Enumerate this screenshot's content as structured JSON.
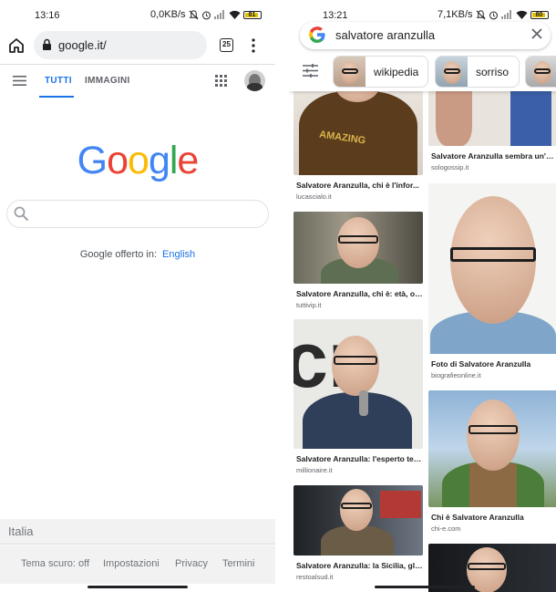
{
  "left": {
    "status": {
      "time": "13:16",
      "net": "0,0KB/s",
      "battery": "81"
    },
    "url": "google.it/",
    "tab_count": "25",
    "tabs": [
      {
        "label": "TUTTI"
      },
      {
        "label": "IMMAGINI"
      }
    ],
    "logo": {
      "G": "G",
      "o1": "o",
      "o2": "o",
      "g": "g",
      "l": "l",
      "e": "e"
    },
    "offered_text": "Google offerto in:",
    "offered_lang": "English",
    "country": "Italia",
    "footer": [
      "Tema scuro: off",
      "Impostazioni",
      "Privacy",
      "Termini"
    ]
  },
  "right": {
    "status": {
      "time": "13:21",
      "net": "7,1KB/s",
      "battery": "80"
    },
    "query": "salvatore aranzulla",
    "chips": [
      {
        "label": "wikipedia"
      },
      {
        "label": "sorriso"
      }
    ],
    "results": [
      {
        "title": "Salvatore Aranzulla, chi è l'infor...",
        "domain": "lucascialo.it"
      },
      {
        "title": "Salvatore Aranzulla, chi è: età, or...",
        "domain": "tuttivip.it"
      },
      {
        "title": "Salvatore Aranzulla: l'esperto tec...",
        "domain": "millionaire.it"
      },
      {
        "title": "Salvatore Aranzulla: la Sicilia, gli ...",
        "domain": "restoalsud.it"
      },
      {
        "title": "Salvatore Aranzulla sembra un'al...",
        "domain": "sologossip.it"
      },
      {
        "title": "Foto di Salvatore Aranzulla",
        "domain": "biografieonline.it"
      },
      {
        "title": "Chi è Salvatore Aranzulla",
        "domain": "chi-e.com"
      }
    ]
  },
  "colors": {
    "accent": "#1a73e8",
    "footer_bg": "#f2f2f2"
  }
}
